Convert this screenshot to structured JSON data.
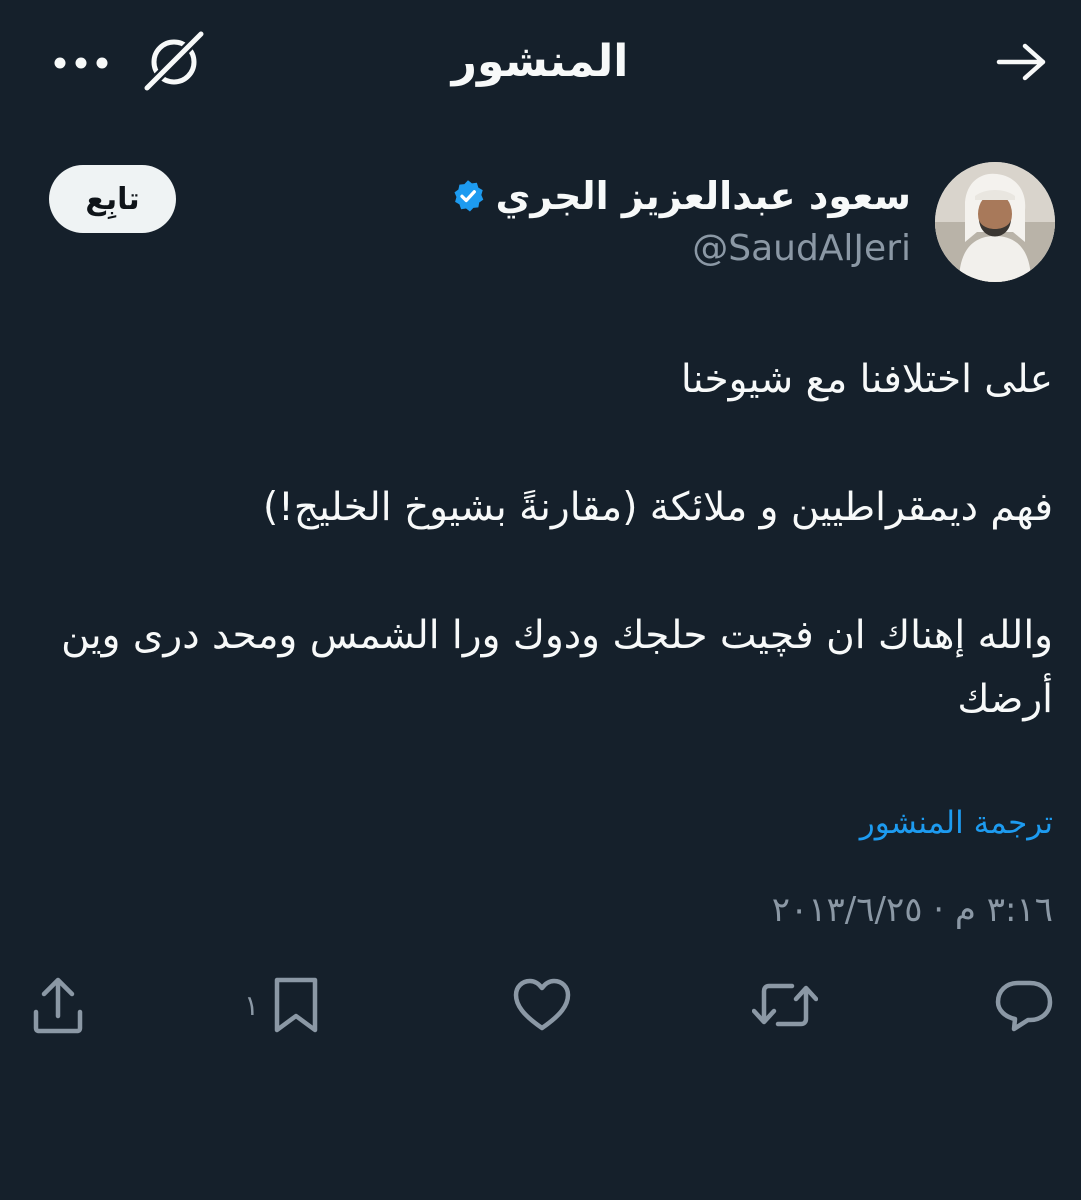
{
  "header": {
    "title": "المنشور",
    "back_icon": "arrow-right-icon",
    "grok_icon": "grok-icon",
    "more_icon": "more-horizontal-icon"
  },
  "author": {
    "display_name": "سعود عبدالعزيز الجري",
    "handle": "@SaudAlJeri",
    "verified": true,
    "verified_color": "#1d9bf0"
  },
  "follow_button": {
    "label": "تابِع"
  },
  "tweet": {
    "paragraphs": [
      "على اختلافنا مع شيوخنا",
      "فهم ديمقراطيين و ملائكة (مقارنةً بشيوخ الخليج!)",
      "والله  إهناك ان فچيت حلجك ودوك ورا الشمس ومحد درى وين أرضك"
    ]
  },
  "translate_label": "ترجمة المنشور",
  "timestamp": "٣:١٦ م · ٢٠١٣/٦/٢٥",
  "actions": {
    "reply_icon": "reply-icon",
    "retweet_icon": "retweet-icon",
    "like_icon": "heart-icon",
    "bookmark_icon": "bookmark-icon",
    "bookmark_count": "١",
    "share_icon": "share-icon"
  },
  "colors": {
    "background": "#15202b",
    "text": "#f7f9f9",
    "secondary_text": "#8b98a5",
    "accent": "#1d9bf0",
    "follow_bg": "#eff3f4"
  }
}
